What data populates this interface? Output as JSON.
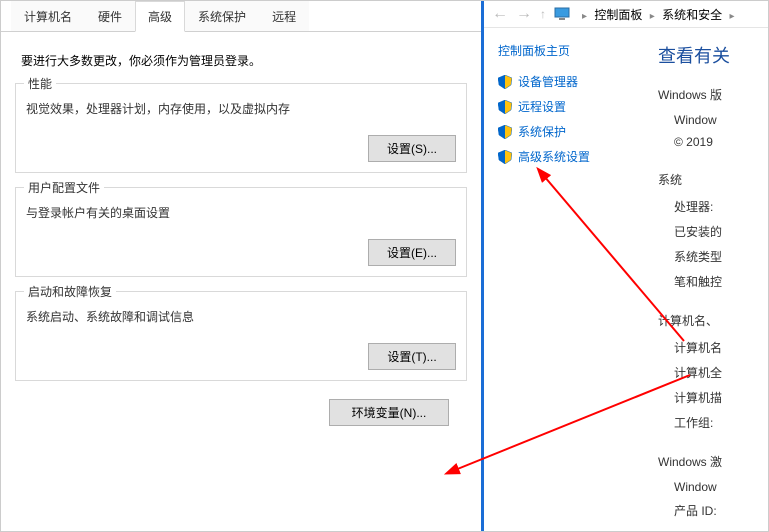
{
  "tabs": {
    "t0": "计算机名",
    "t1": "硬件",
    "t2": "高级",
    "t3": "系统保护",
    "t4": "远程"
  },
  "intro": "要进行大多数更改，你必须作为管理员登录。",
  "groups": {
    "perf": {
      "title": "性能",
      "desc": "视觉效果，处理器计划，内存使用，以及虚拟内存",
      "btn": "设置(S)..."
    },
    "profile": {
      "title": "用户配置文件",
      "desc": "与登录帐户有关的桌面设置",
      "btn": "设置(E)..."
    },
    "startup": {
      "title": "启动和故障恢复",
      "desc": "系统启动、系统故障和调试信息",
      "btn": "设置(T)..."
    }
  },
  "envBtn": "环境变量(N)...",
  "breadcrumb": {
    "a": "控制面板",
    "b": "系统和安全"
  },
  "homeLink": "控制面板主页",
  "links": {
    "dev": "设备管理器",
    "remote": "远程设置",
    "protect": "系统保护",
    "adv": "高级系统设置"
  },
  "info": {
    "title": "查看有关",
    "winEdHead": "Windows 版",
    "winEdSub": "Window",
    "copyright": "© 2019",
    "sysHead": "系统",
    "cpu": "处理器:",
    "ram": "已安装的",
    "type": "系统类型",
    "pen": "笔和触控",
    "pcHead": "计算机名、",
    "pcName": "计算机名",
    "pcFull": "计算机全",
    "pcDesc": "计算机描",
    "workgroup": "工作组:",
    "actHead": "Windows 激",
    "actSub": "Window",
    "prodId": "产品 ID:"
  }
}
